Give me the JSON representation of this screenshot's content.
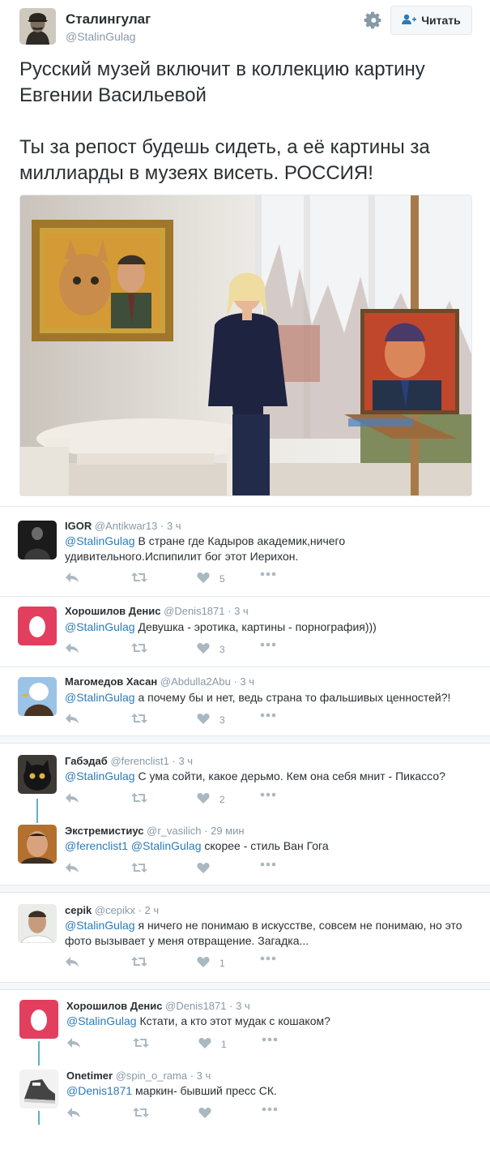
{
  "author": {
    "name": "Сталингулаг",
    "handle": "@StalinGulag",
    "follow_label": "Читать"
  },
  "tweet": {
    "text": "Русский музей включит в коллекцию картину Евгении Васильевой\n\nТы за репост будешь сидеть, а её картины за миллиарды в музеях висеть. РОССИЯ!"
  },
  "replies": [
    {
      "name": "IGOR",
      "handle": "@Antikwar13",
      "time": "3 ч",
      "mention": "@StalinGulag",
      "text": " В стране где Кадыров академик,ничего удивительного.Испипилит бог этот Иерихон.",
      "likes": "5"
    },
    {
      "name": "Хорошилов Денис",
      "handle": "@Denis1871",
      "time": "3 ч",
      "mention": "@StalinGulag",
      "text": " Девушка - эротика, картины - порнография)))",
      "likes": "3"
    },
    {
      "name": "Магомедов Хасан",
      "handle": "@Abdulla2Abu",
      "time": "3 ч",
      "mention": "@StalinGulag",
      "text": " а почему бы и нет,  ведь страна то фальшивых ценностей?!",
      "likes": "3"
    },
    {
      "name": "Габэдаб",
      "handle": "@ferenclist1",
      "time": "3 ч",
      "mention": "@StalinGulag",
      "text": " С ума сойти, какое дерьмо. Кем она себя мнит - Пикассо?",
      "likes": "2"
    },
    {
      "name": "Экстремистиус",
      "handle": "@r_vasilich",
      "time": "29 мин",
      "mention": "@ferenclist1 @StalinGulag",
      "text": " скорее - стиль Ван Гога",
      "likes": ""
    },
    {
      "name": "серik",
      "handle": "@cepikx",
      "time": "2 ч",
      "mention": "@StalinGulag",
      "text": " я ничего не понимаю в искусстве, совсем не понимаю, но это фото вызывает у меня отвращение. Загадка...",
      "likes": "1"
    },
    {
      "name": "Хорошилов Денис",
      "handle": "@Denis1871",
      "time": "3 ч",
      "mention": "@StalinGulag",
      "text": " Кстати, а кто этот мудак с кошаком?",
      "likes": "1"
    },
    {
      "name": "Onetimer",
      "handle": "@spin_o_rama",
      "time": "3 ч",
      "mention": "@Denis1871",
      "text": " маркин- бывший пресс СК.",
      "likes": ""
    }
  ],
  "icons": {
    "gear": "gear-icon",
    "follow": "add-user-icon",
    "reply": "reply-icon",
    "retweet": "retweet-icon",
    "like": "heart-icon",
    "more": "more-icon"
  },
  "colors": {
    "link": "#2b7bb9",
    "thread_line": "#5db2c3",
    "muted": "#8899a6"
  }
}
